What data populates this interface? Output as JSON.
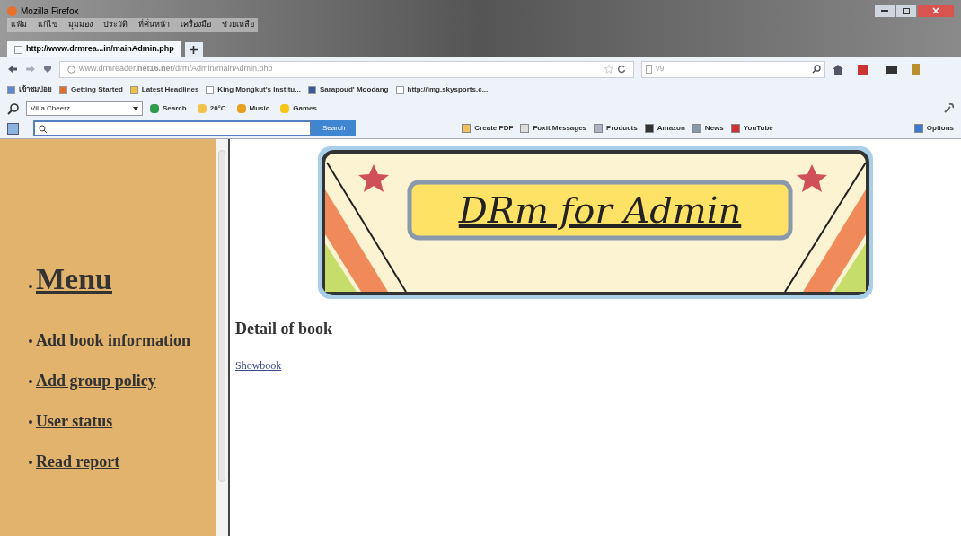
{
  "window": {
    "title": "Mozilla Firefox"
  },
  "menu_bar": [
    "แฟ้ม",
    "แก้ไข",
    "มุมมอง",
    "ประวัติ",
    "ที่คั่นหน้า",
    "เครื่องมือ",
    "ช่วยเหลือ"
  ],
  "tabs": [
    {
      "label": "http://www.drmrea...in/mainAdmin.php",
      "selected": true
    }
  ],
  "address_bar": {
    "url": "www.drmreader.**net16.net**/drm/Admin/mainAdmin.php"
  },
  "search_box": {
    "placeholder": "v9"
  },
  "bookmarks": [
    "เข้าชมบ่อย",
    "Getting Started",
    "Latest Headlines",
    "King Mongkut's Institu...",
    "Sarapoud' Moodang",
    "http://img.skysports.c..."
  ],
  "toolbar_1": {
    "profile": "ViLa Cheerz",
    "items": [
      "Search",
      "20°C",
      "Music",
      "Games"
    ]
  },
  "toolbar_2": {
    "search_button": "Search",
    "items": [
      "Create PDF",
      "Foxit Messages",
      "Products",
      "Amazon",
      "News",
      "YouTube",
      "Options"
    ]
  },
  "sidebar": {
    "heading": "Menu",
    "items": [
      "Add book information",
      "Add group policy",
      "User status",
      "Read report"
    ]
  },
  "main": {
    "banner": "DRm for Admin",
    "heading": "Detail of book",
    "link": "Showbook"
  }
}
